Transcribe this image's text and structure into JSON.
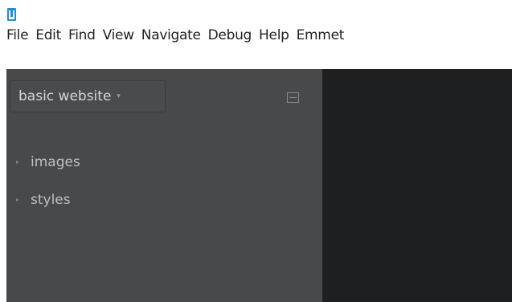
{
  "menubar": {
    "items": [
      "File",
      "Edit",
      "Find",
      "View",
      "Navigate",
      "Debug",
      "Help",
      "Emmet"
    ]
  },
  "sidebar": {
    "project_title": "basic website",
    "dropdown_arrow": "▾",
    "tree": [
      {
        "label": "images",
        "caret": "▸"
      },
      {
        "label": "styles",
        "caret": "▸"
      }
    ]
  },
  "icons": {
    "app": "brackets-app-icon",
    "split": "split-view-icon"
  },
  "colors": {
    "sidebar_bg": "#47494b",
    "editor_bg": "#1d1f21",
    "menubar_bg": "#ffffff",
    "app_icon": "#1f8fd6"
  }
}
